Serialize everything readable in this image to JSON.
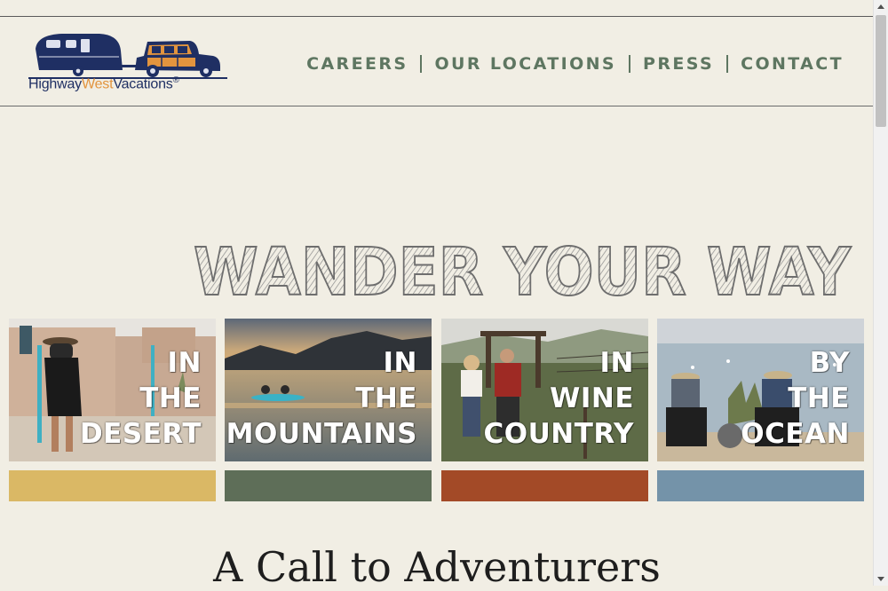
{
  "logo": {
    "text_part1": "Highway",
    "text_part2": "West",
    "text_part3": "Vacations",
    "registered": "®",
    "brand_navy": "#1f2f63",
    "brand_orange": "#e2943e"
  },
  "nav": {
    "items": [
      {
        "label": "CAREERS"
      },
      {
        "label": "OUR LOCATIONS"
      },
      {
        "label": "PRESS"
      },
      {
        "label": "CONTACT"
      }
    ],
    "color": "#5e7661"
  },
  "hero": {
    "headline": "WANDER YOUR WAY"
  },
  "destinations": [
    {
      "line1": "IN",
      "line2": "THE",
      "line3": "DESERT",
      "bar_color": "#dab865"
    },
    {
      "line1": "IN",
      "line2": "THE",
      "line3": "MOUNTAINS",
      "bar_color": "#5e6e58"
    },
    {
      "line1": "IN",
      "line2": "WINE",
      "line3": "COUNTRY",
      "bar_color": "#a34a27"
    },
    {
      "line1": "BY",
      "line2": "THE",
      "line3": "OCEAN",
      "bar_color": "#7493a9"
    }
  ],
  "section": {
    "title": "A Call to Adventurers"
  }
}
